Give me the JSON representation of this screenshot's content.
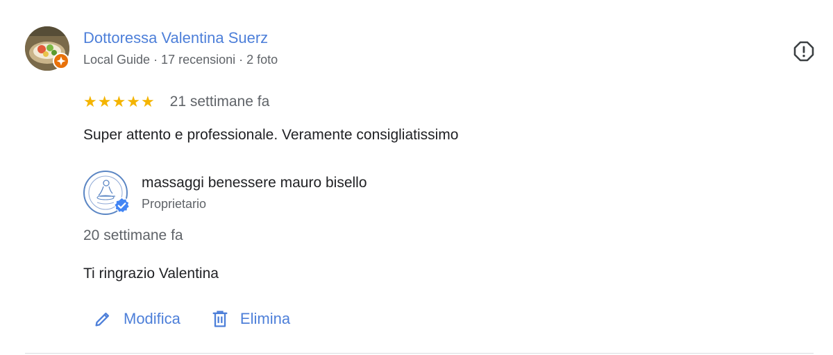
{
  "reviewer": {
    "name": "Dottoressa Valentina Suerz",
    "meta": "Local Guide · 17 recensioni · 2 foto",
    "avatar_icon": "profile-photo",
    "badge_icon": "local-guide-star-icon",
    "badge_color": "#e8710a"
  },
  "report_icon": "report-flag-icon",
  "rating": {
    "stars": 5,
    "star_glyph": "★",
    "star_color": "#f4b400",
    "date": "21 settimane fa"
  },
  "review_text": "Super attento e professionale. Veramente consigliatissimo",
  "owner_reply": {
    "name": "massaggi benessere mauro bisello",
    "role": "Proprietario",
    "verified_icon": "verified-check-icon",
    "verified_color": "#4285f4",
    "date": "20 settimane fa",
    "text": "Ti ringrazio Valentina"
  },
  "actions": {
    "edit_label": "Modifica",
    "edit_icon": "pencil-icon",
    "delete_label": "Elimina",
    "delete_icon": "trash-icon"
  },
  "colors": {
    "link": "#4d7fd9",
    "primary_text": "#202124",
    "secondary_text": "#5f6368",
    "divider": "#dadce0"
  }
}
